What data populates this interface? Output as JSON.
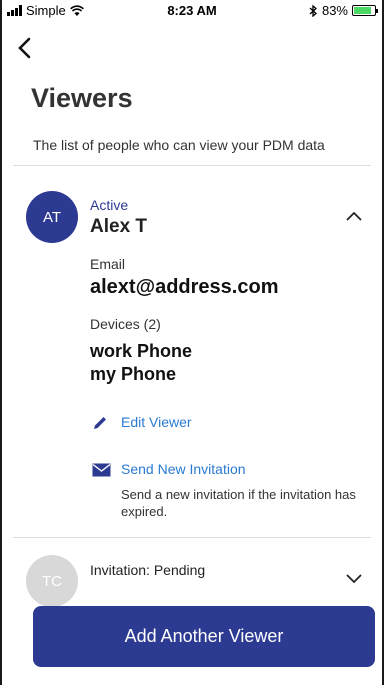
{
  "status_bar": {
    "carrier": "Simple",
    "time": "8:23 AM",
    "battery": "83%",
    "battery_level": 0.83,
    "icons": [
      "signal-icon",
      "wifi-icon",
      "bluetooth-icon",
      "battery-icon"
    ]
  },
  "nav": {
    "back_icon": "chevron-left-icon"
  },
  "page": {
    "title": "Viewers",
    "subtitle": "The list of people who can view your PDM data"
  },
  "viewers": [
    {
      "initials": "AT",
      "status": "Active",
      "name": "Alex T",
      "email_label": "Email",
      "email": "alext@address.com",
      "devices_label": "Devices (2)",
      "devices": [
        "work Phone",
        "my Phone"
      ],
      "expanded": true,
      "actions": {
        "edit": "Edit Viewer",
        "resend": "Send New Invitation",
        "resend_help": "Send a new invitation if the invitation has expired."
      }
    },
    {
      "initials": "TC",
      "status": "Invitation: Pending",
      "expanded": false
    }
  ],
  "cta": {
    "label": "Add Another Viewer"
  },
  "colors": {
    "primary": "#2d3a92",
    "link": "#2b7ad1",
    "avatar_pending": "#d8d8d8",
    "battery": "#4cd964"
  }
}
